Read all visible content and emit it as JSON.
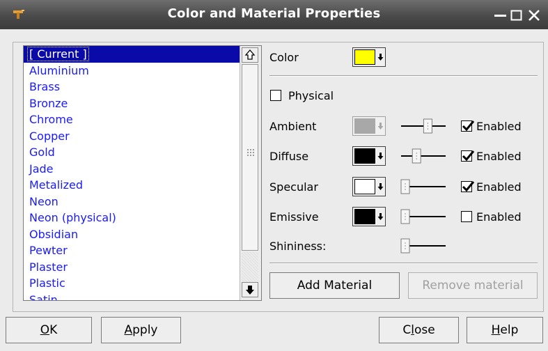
{
  "window": {
    "title": "Color and Material Properties"
  },
  "materials": {
    "items": [
      "[ Current ]",
      "Aluminium",
      "Brass",
      "Bronze",
      "Chrome",
      "Copper",
      "Gold",
      "Jade",
      "Metalized",
      "Neon",
      "Neon (physical)",
      "Obsidian",
      "Pewter",
      "Plaster",
      "Plastic",
      "Satin"
    ],
    "selected": "[ Current ]"
  },
  "color": {
    "label": "Color",
    "value": "#ffff00"
  },
  "physical": {
    "label": "Physical",
    "checked": false
  },
  "properties": [
    {
      "label": "Ambient",
      "color": "#a8a8a8",
      "disabled": true,
      "slider_level": 0.6,
      "enabled_label": "Enabled",
      "enabled": true
    },
    {
      "label": "Diffuse",
      "color": "#000000",
      "disabled": false,
      "slider_level": 0.3,
      "enabled_label": "Enabled",
      "enabled": true
    },
    {
      "label": "Specular",
      "color": "#ffffff",
      "disabled": false,
      "slider_level": 0.0,
      "enabled_label": "Enabled",
      "enabled": true
    },
    {
      "label": "Emissive",
      "color": "#000000",
      "disabled": false,
      "slider_level": 0.0,
      "enabled_label": "Enabled",
      "enabled": false
    }
  ],
  "shininess": {
    "label": "Shininess:",
    "slider_level": 0.0
  },
  "buttons": {
    "add_material": "Add Material",
    "remove_material": "Remove material",
    "ok": "OK",
    "apply": "Apply",
    "close": "Close",
    "help": "Help"
  }
}
